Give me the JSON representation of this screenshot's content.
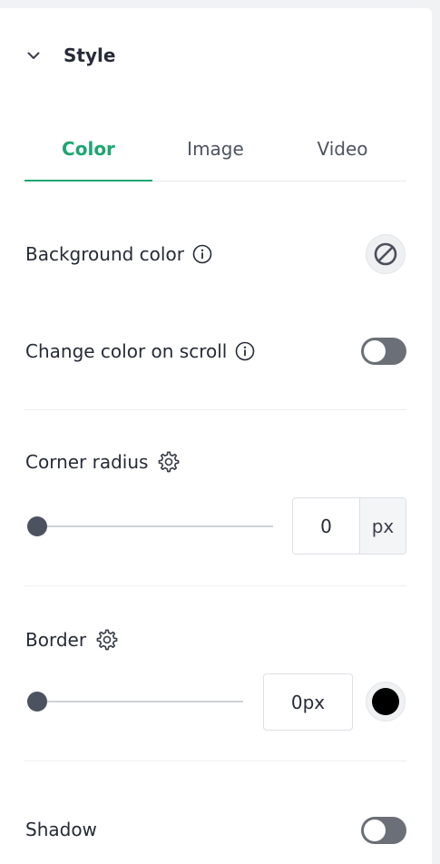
{
  "section": {
    "title": "Style"
  },
  "tabs": [
    {
      "label": "Color",
      "active": true
    },
    {
      "label": "Image",
      "active": false
    },
    {
      "label": "Video",
      "active": false
    }
  ],
  "background_color": {
    "label": "Background color",
    "value": "none"
  },
  "change_color_on_scroll": {
    "label": "Change color on scroll",
    "enabled": false
  },
  "corner_radius": {
    "label": "Corner radius",
    "value": "0",
    "unit": "px",
    "slider_fraction": 0
  },
  "border": {
    "label": "Border",
    "value": "0px",
    "slider_fraction": 0,
    "color": "#000000"
  },
  "shadow": {
    "label": "Shadow",
    "enabled": false
  },
  "colors": {
    "accent": "#1ea671",
    "toggle_off": "#6b6f77",
    "slider_thumb": "#4d5260"
  }
}
